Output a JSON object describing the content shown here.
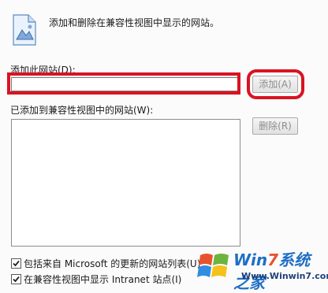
{
  "header": {
    "description": "添加和删除在兼容性视图中显示的网站。"
  },
  "add_site": {
    "label": "添加此网站(D):",
    "input_value": "",
    "add_button_label": "添加(A)"
  },
  "site_list": {
    "label": "已添加到兼容性视图中的网站(W):",
    "items": [],
    "remove_button_label": "删除(R)"
  },
  "options": [
    {
      "label": "包括来自 Microsoft 的更新的网站列表(U)",
      "checked": true
    },
    {
      "label": "在兼容性视图中显示 Intranet 站点(I)",
      "checked": true
    }
  ],
  "watermark": {
    "brand_win": "Win",
    "brand_num": "7",
    "brand_cn": "系统之家",
    "url": "Www.Winwin7.com"
  },
  "colors": {
    "highlight_red": "#d91322",
    "disabled_text": "#8d8d8d"
  }
}
